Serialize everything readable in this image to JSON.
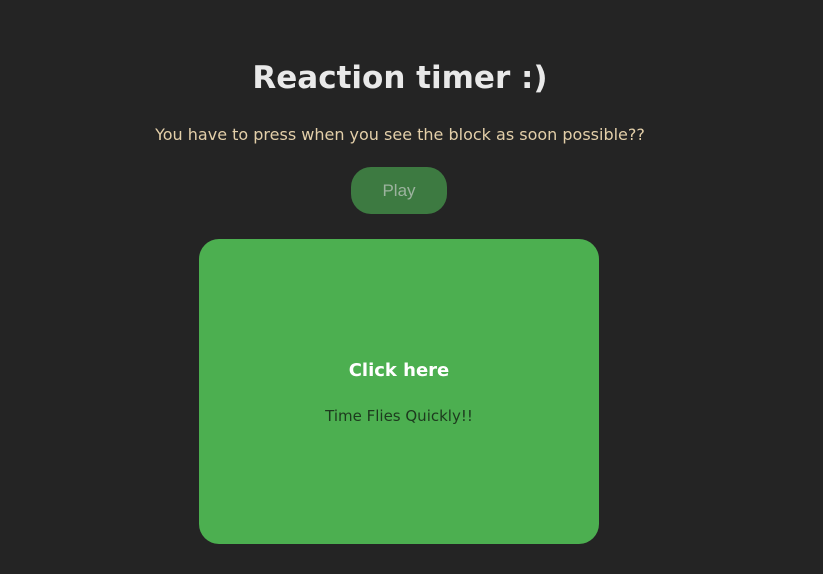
{
  "page": {
    "title": "Reaction timer :)",
    "instructions": "You have to press when you see the block as soon possible??"
  },
  "controls": {
    "play_label": "Play"
  },
  "block": {
    "title": "Click here",
    "message": "Time Flies Quickly!!",
    "color": "#4caf50"
  },
  "colors": {
    "background": "#242424",
    "title": "#e9e9e9",
    "instructions": "#e3cfa9",
    "play_button": "#3d7a41"
  }
}
